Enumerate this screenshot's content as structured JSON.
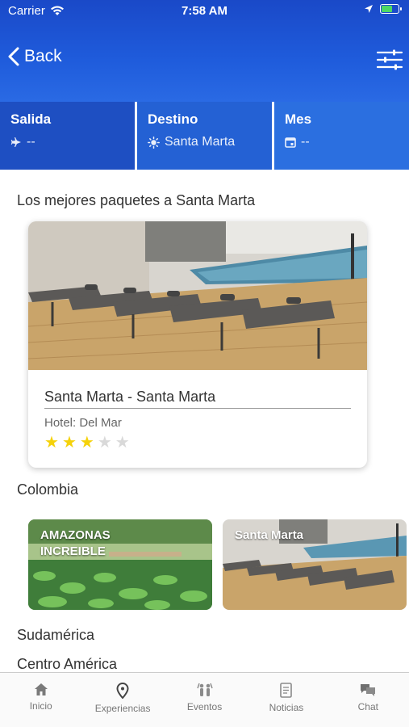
{
  "status_bar": {
    "carrier": "Carrier",
    "time": "7:58 AM"
  },
  "nav": {
    "back_label": "Back"
  },
  "search": {
    "departure": {
      "label": "Salida",
      "value": "--"
    },
    "destination": {
      "label": "Destino",
      "value": "Santa Marta"
    },
    "month": {
      "label": "Mes",
      "value": "--"
    }
  },
  "sections": {
    "best_packages": "Los mejores paquetes a Santa Marta",
    "colombia": "Colombia",
    "south_america": "Sudamérica",
    "central_america": "Centro América"
  },
  "package": {
    "title": "Santa Marta - Santa Marta",
    "hotel": "Hotel: Del Mar",
    "rating": 3,
    "max_rating": 5
  },
  "colombia_cards": [
    {
      "label": "AMAZONAS INCREIBLE"
    },
    {
      "label": "Santa Marta"
    }
  ],
  "tabs": [
    {
      "label": "Inicio",
      "icon": "home-icon"
    },
    {
      "label": "Experiencias",
      "icon": "location-pin-icon"
    },
    {
      "label": "Eventos",
      "icon": "people-icon"
    },
    {
      "label": "Noticias",
      "icon": "news-icon"
    },
    {
      "label": "Chat",
      "icon": "chat-icon"
    }
  ],
  "colors": {
    "header_blue": "#1f5cdc",
    "star_filled": "#f5d20a",
    "star_empty": "#d9d9d9"
  }
}
